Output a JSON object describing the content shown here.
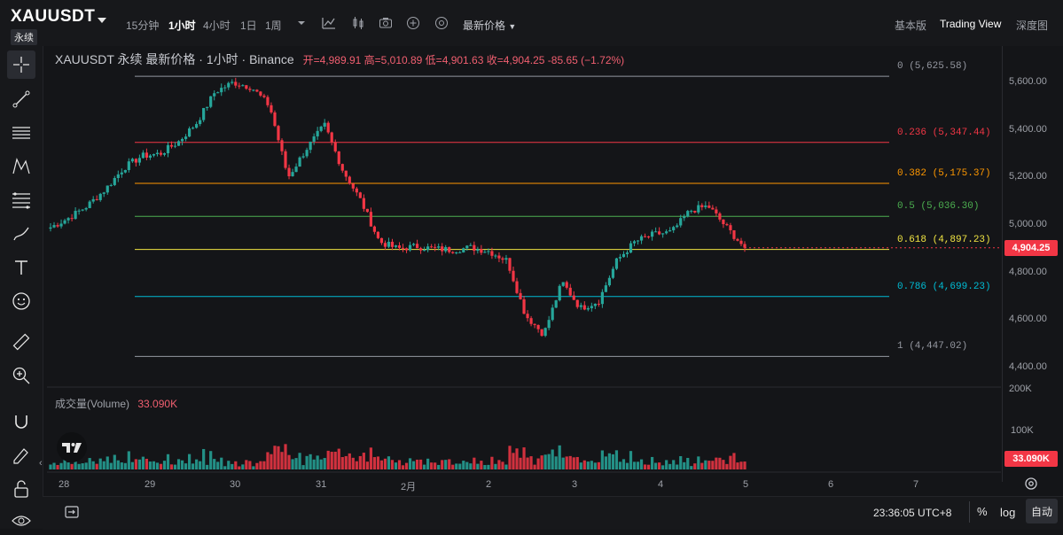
{
  "header": {
    "symbol": "XAUUSDT",
    "contract_tag": "永续",
    "intervals": [
      "15分钟",
      "1小时",
      "4小时",
      "1日",
      "1周"
    ],
    "active_interval": "1小时",
    "price_type": "最新价格",
    "right_tabs": [
      "基本版",
      "Trading View",
      "深度图"
    ],
    "active_right_tab": "Trading View"
  },
  "legend": {
    "title": "XAUUSDT 永续 最新价格 · 1小时 · Binance",
    "ohlc": "开=4,989.91 高=5,010.89 低=4,901.63 收=4,904.25 -85.65 (−1.72%)"
  },
  "volume": {
    "label": "成交量(Volume)",
    "value": "33.090K"
  },
  "fib_levels": [
    {
      "label": "0 (5,625.58)",
      "price": 5625.58,
      "color": "#9598a1"
    },
    {
      "label": "0.236 (5,347.44)",
      "price": 5347.44,
      "color": "#f23645"
    },
    {
      "label": "0.382 (5,175.37)",
      "price": 5175.37,
      "color": "#ff9800"
    },
    {
      "label": "0.5 (5,036.30)",
      "price": 5036.3,
      "color": "#4caf50"
    },
    {
      "label": "0.618 (4,897.23)",
      "price": 4897.23,
      "color": "#f0e442"
    },
    {
      "label": "0.786 (4,699.23)",
      "price": 4699.23,
      "color": "#00bcd4"
    },
    {
      "label": "1 (4,447.02)",
      "price": 4447.02,
      "color": "#9598a1"
    }
  ],
  "price_axis": {
    "ticks": [
      "5,600.00",
      "5,400.00",
      "5,200.00",
      "5,000.00",
      "4,800.00",
      "4,600.00",
      "4,400.00"
    ],
    "current_price": "4,904.25"
  },
  "volume_axis": {
    "ticks": [
      "200K",
      "100K"
    ]
  },
  "time_axis": {
    "ticks": [
      "28",
      "29",
      "30",
      "31",
      "2月",
      "2",
      "3",
      "4",
      "5",
      "6",
      "7"
    ]
  },
  "footer": {
    "clock": "23:36:05 UTC+8",
    "percent": "%",
    "log": "log",
    "auto": "自动"
  },
  "colors": {
    "up": "#26a69a",
    "down": "#f23645",
    "background": "#141518"
  },
  "chart_data": {
    "type": "candlestick",
    "interval": "1小时",
    "ylim": [
      4350,
      5700
    ],
    "close_path": [
      {
        "day": "28",
        "close": 4990
      },
      {
        "day": "28",
        "close": 5030
      },
      {
        "day": "28",
        "close": 5080
      },
      {
        "day": "28",
        "close": 5150
      },
      {
        "day": "28",
        "close": 5240
      },
      {
        "day": "28",
        "close": 5290
      },
      {
        "day": "29",
        "close": 5300
      },
      {
        "day": "29",
        "close": 5350
      },
      {
        "day": "29",
        "close": 5430
      },
      {
        "day": "29",
        "close": 5560
      },
      {
        "day": "29",
        "close": 5600
      },
      {
        "day": "29",
        "close": 5580
      },
      {
        "day": "30",
        "close": 5500
      },
      {
        "day": "30",
        "close": 5200
      },
      {
        "day": "30",
        "close": 5320
      },
      {
        "day": "30",
        "close": 5420
      },
      {
        "day": "30",
        "close": 5230
      },
      {
        "day": "31",
        "close": 5100
      },
      {
        "day": "31",
        "close": 4930
      },
      {
        "day": "31",
        "close": 4900
      },
      {
        "day": "31",
        "close": 4910
      },
      {
        "day": "2月",
        "close": 4900
      },
      {
        "day": "2月",
        "close": 4895
      },
      {
        "day": "2月",
        "close": 4905
      },
      {
        "day": "2",
        "close": 4890
      },
      {
        "day": "2",
        "close": 4850
      },
      {
        "day": "2",
        "close": 4620
      },
      {
        "day": "2",
        "close": 4540
      },
      {
        "day": "2",
        "close": 4760
      },
      {
        "day": "3",
        "close": 4650
      },
      {
        "day": "3",
        "close": 4680
      },
      {
        "day": "3",
        "close": 4850
      },
      {
        "day": "3",
        "close": 4930
      },
      {
        "day": "4",
        "close": 4960
      },
      {
        "day": "4",
        "close": 4970
      },
      {
        "day": "4",
        "close": 5060
      },
      {
        "day": "4",
        "close": 5080
      },
      {
        "day": "4",
        "close": 4990
      },
      {
        "day": "5",
        "close": 4904.25
      }
    ]
  }
}
